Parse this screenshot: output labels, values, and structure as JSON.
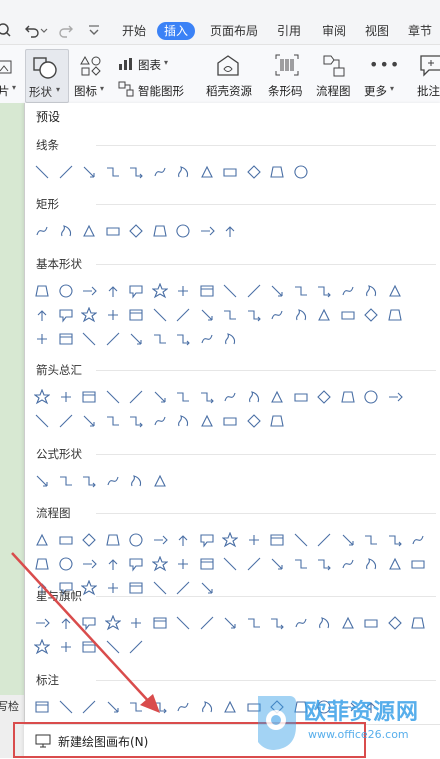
{
  "toolbar": {
    "tabs": [
      "开始",
      "插入",
      "页面布局",
      "引用",
      "审阅",
      "视图",
      "章节"
    ],
    "active_tab": "插入",
    "accent_color": "#3b82f6"
  },
  "ribbon": {
    "shape_label": "形状",
    "icon_label": "图标",
    "chart_label": "图表",
    "smartart_label": "智能图形",
    "stock_label": "稻壳资源",
    "barcode_label": "条形码",
    "flowchart_label": "流程图",
    "more_label": "更多",
    "comment_label": "批注",
    "left_partial": "片"
  },
  "panel": {
    "preset_label": "预设",
    "sections": [
      "线条",
      "矩形",
      "基本形状",
      "箭头总汇",
      "公式形状",
      "流程图",
      "星与旗帜",
      "标注"
    ],
    "new_canvas_label": "新建绘图画布(N)"
  },
  "side": {
    "bottom_text": "写检"
  },
  "watermark": {
    "title": "欧菲资源网",
    "url": "www.office26.com",
    "color": "#3aa0e8"
  },
  "annotation": {
    "arrow_color": "#d94c4c",
    "box_color": "#d94c4c"
  }
}
